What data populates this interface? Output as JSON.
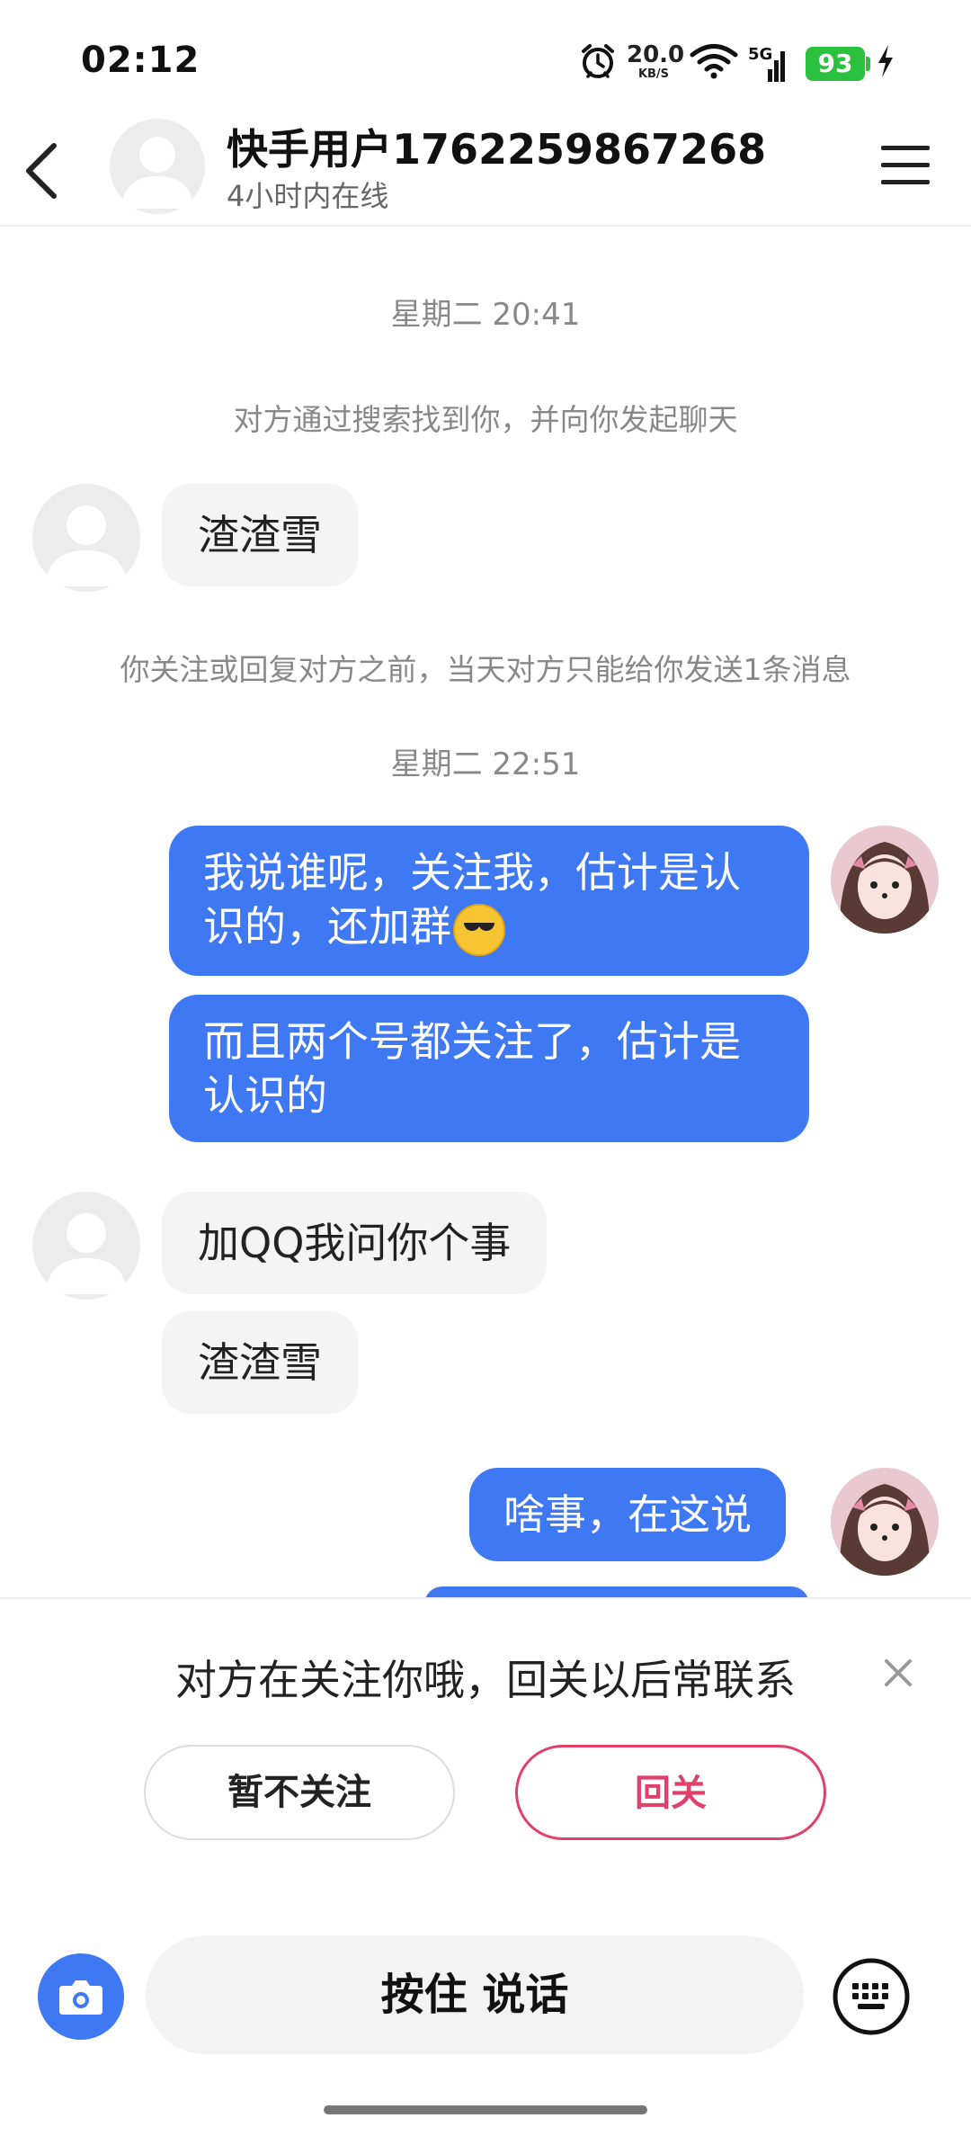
{
  "status_bar": {
    "time": "02:12",
    "net_speed_value": "20.0",
    "net_speed_unit": "KB/S",
    "network": "5G",
    "battery": "93",
    "battery_color": "#2bc03e"
  },
  "header": {
    "name": "快手用户1762259867268",
    "status": "4小时内在线"
  },
  "chat": {
    "timestamp_1": "星期二 20:41",
    "system_note_1": "对方通过搜索找到你，并向你发起聊天",
    "msg_in_1": "渣渣雪",
    "system_note_2": "你关注或回复对方之前，当天对方只能给你发送1条消息",
    "timestamp_2": "星期二 22:51",
    "msg_out_1": "我说谁呢，关注我，估计是认识的，还加群",
    "msg_out_1_emoji": "smirk-emoji",
    "msg_out_2": "而且两个号都关注了，估计是认识的",
    "msg_in_2": "加QQ我问你个事",
    "msg_in_3": "渣渣雪",
    "msg_out_3": "啥事，在这说"
  },
  "follow_prompt": {
    "text": "对方在关注你哦，回关以后常联系",
    "not_follow_label": "暂不关注",
    "follow_back_label": "回关",
    "accent_color": "#e0416a"
  },
  "input_bar": {
    "hold_to_talk_label": "按住 说话",
    "camera_icon": "camera-icon",
    "keyboard_icon": "keyboard-icon"
  },
  "colors": {
    "outgoing_bubble": "#3f78f3",
    "incoming_bubble": "#f4f4f4"
  }
}
